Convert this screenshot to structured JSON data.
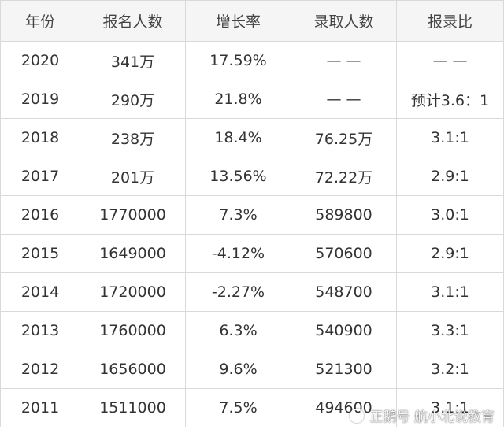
{
  "headers": [
    "年份",
    "报名人数",
    "增长率",
    "录取人数",
    "报录比"
  ],
  "rows": [
    {
      "year": "2020",
      "applicants": "341万",
      "growth": "17.59%",
      "admitted": "— —",
      "ratio": "— —"
    },
    {
      "year": "2019",
      "applicants": "290万",
      "growth": "21.8%",
      "admitted": "— —",
      "ratio": "预计3.6：1"
    },
    {
      "year": "2018",
      "applicants": "238万",
      "growth": "18.4%",
      "admitted": "76.25万",
      "ratio": "3.1:1"
    },
    {
      "year": "2017",
      "applicants": "201万",
      "growth": "13.56%",
      "admitted": "72.22万",
      "ratio": "2.9:1"
    },
    {
      "year": "2016",
      "applicants": "1770000",
      "growth": "7.3%",
      "admitted": "589800",
      "ratio": "3.0:1"
    },
    {
      "year": "2015",
      "applicants": "1649000",
      "growth": "-4.12%",
      "admitted": "570600",
      "ratio": "2.9:1"
    },
    {
      "year": "2014",
      "applicants": "1720000",
      "growth": "-2.27%",
      "admitted": "548700",
      "ratio": "3.1:1"
    },
    {
      "year": "2013",
      "applicants": "1760000",
      "growth": "6.3%",
      "admitted": "540900",
      "ratio": "3.3:1"
    },
    {
      "year": "2012",
      "applicants": "1656000",
      "growth": "9.6%",
      "admitted": "521300",
      "ratio": "3.2:1"
    },
    {
      "year": "2011",
      "applicants": "1511000",
      "growth": "7.5%",
      "admitted": "494600",
      "ratio": "3.1:1"
    }
  ],
  "highlight_color": "#2a8a7a",
  "watermark": {
    "text": "正鹅号 航小北说教育",
    "icon": "circle-logo-icon"
  }
}
